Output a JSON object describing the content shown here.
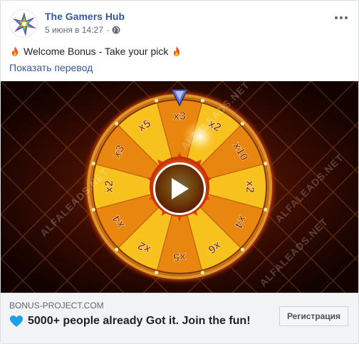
{
  "post": {
    "page_name": "The Gamers Hub",
    "timestamp": "5 июня в 14:27",
    "separator": "·",
    "privacy_icon": "globe-icon",
    "text": "Welcome Bonus - Take your pick",
    "text_icon": "fire-icon",
    "translate_link": "Показать перевод",
    "more_icon": "more-options-icon"
  },
  "media": {
    "type": "video",
    "play_icon": "play-icon",
    "watermark": "ALFALEADS.NET",
    "wheel_segments": [
      "x2",
      "x10",
      "x2",
      "x4",
      "x6",
      "x5",
      "x2",
      "x4",
      "x2",
      "x3",
      "x5",
      "x3"
    ]
  },
  "link_preview": {
    "domain": "BONUS-PROJECT.COM",
    "headline": "5000+ people already Got it. Join the fun!",
    "headline_icon": "blue-heart-icon",
    "cta_label": "Регистрация"
  },
  "colors": {
    "page_name": "#365899",
    "link": "#385898",
    "secondary_text": "#606770",
    "preview_bg": "#f2f3f5",
    "heart": "#1ea0e8"
  }
}
